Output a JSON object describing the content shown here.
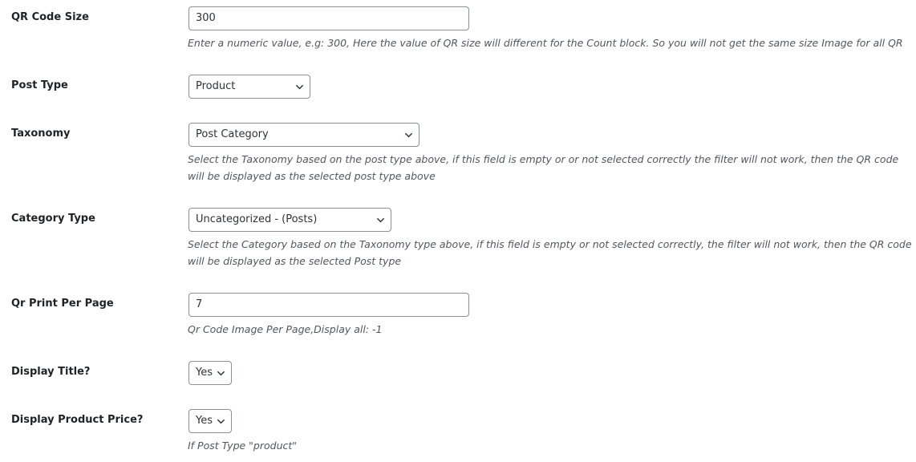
{
  "qr_code_size": {
    "label": "QR Code Size",
    "value": "300",
    "description": "Enter a numeric value, e.g: 300, Here the value of QR size will different for the Count block. So you will not get the same size Image for all QR"
  },
  "post_type": {
    "label": "Post Type",
    "selected": "Product"
  },
  "taxonomy": {
    "label": "Taxonomy",
    "selected": "Post Category",
    "description": "Select the Taxonomy based on the post type above, if this field is empty or or not selected correctly the filter will not work, then the QR code will be displayed as the selected post type above"
  },
  "category_type": {
    "label": "Category Type",
    "selected": "Uncategorized - (Posts)",
    "description": "Select the Category based on the Taxonomy type above, if this field is empty or not selected correctly, the filter will not work, then the QR code will be displayed as the selected Post type"
  },
  "qr_print_per_page": {
    "label": "Qr Print Per Page",
    "value": "7",
    "description": "Qr Code Image Per Page,Display all: -1"
  },
  "display_title": {
    "label": "Display Title?",
    "selected": "Yes"
  },
  "display_product_price": {
    "label": "Display Product Price?",
    "selected": "Yes",
    "description": "If Post Type \"product\""
  },
  "icons": {
    "dropdown": "chevron-down-icon"
  }
}
